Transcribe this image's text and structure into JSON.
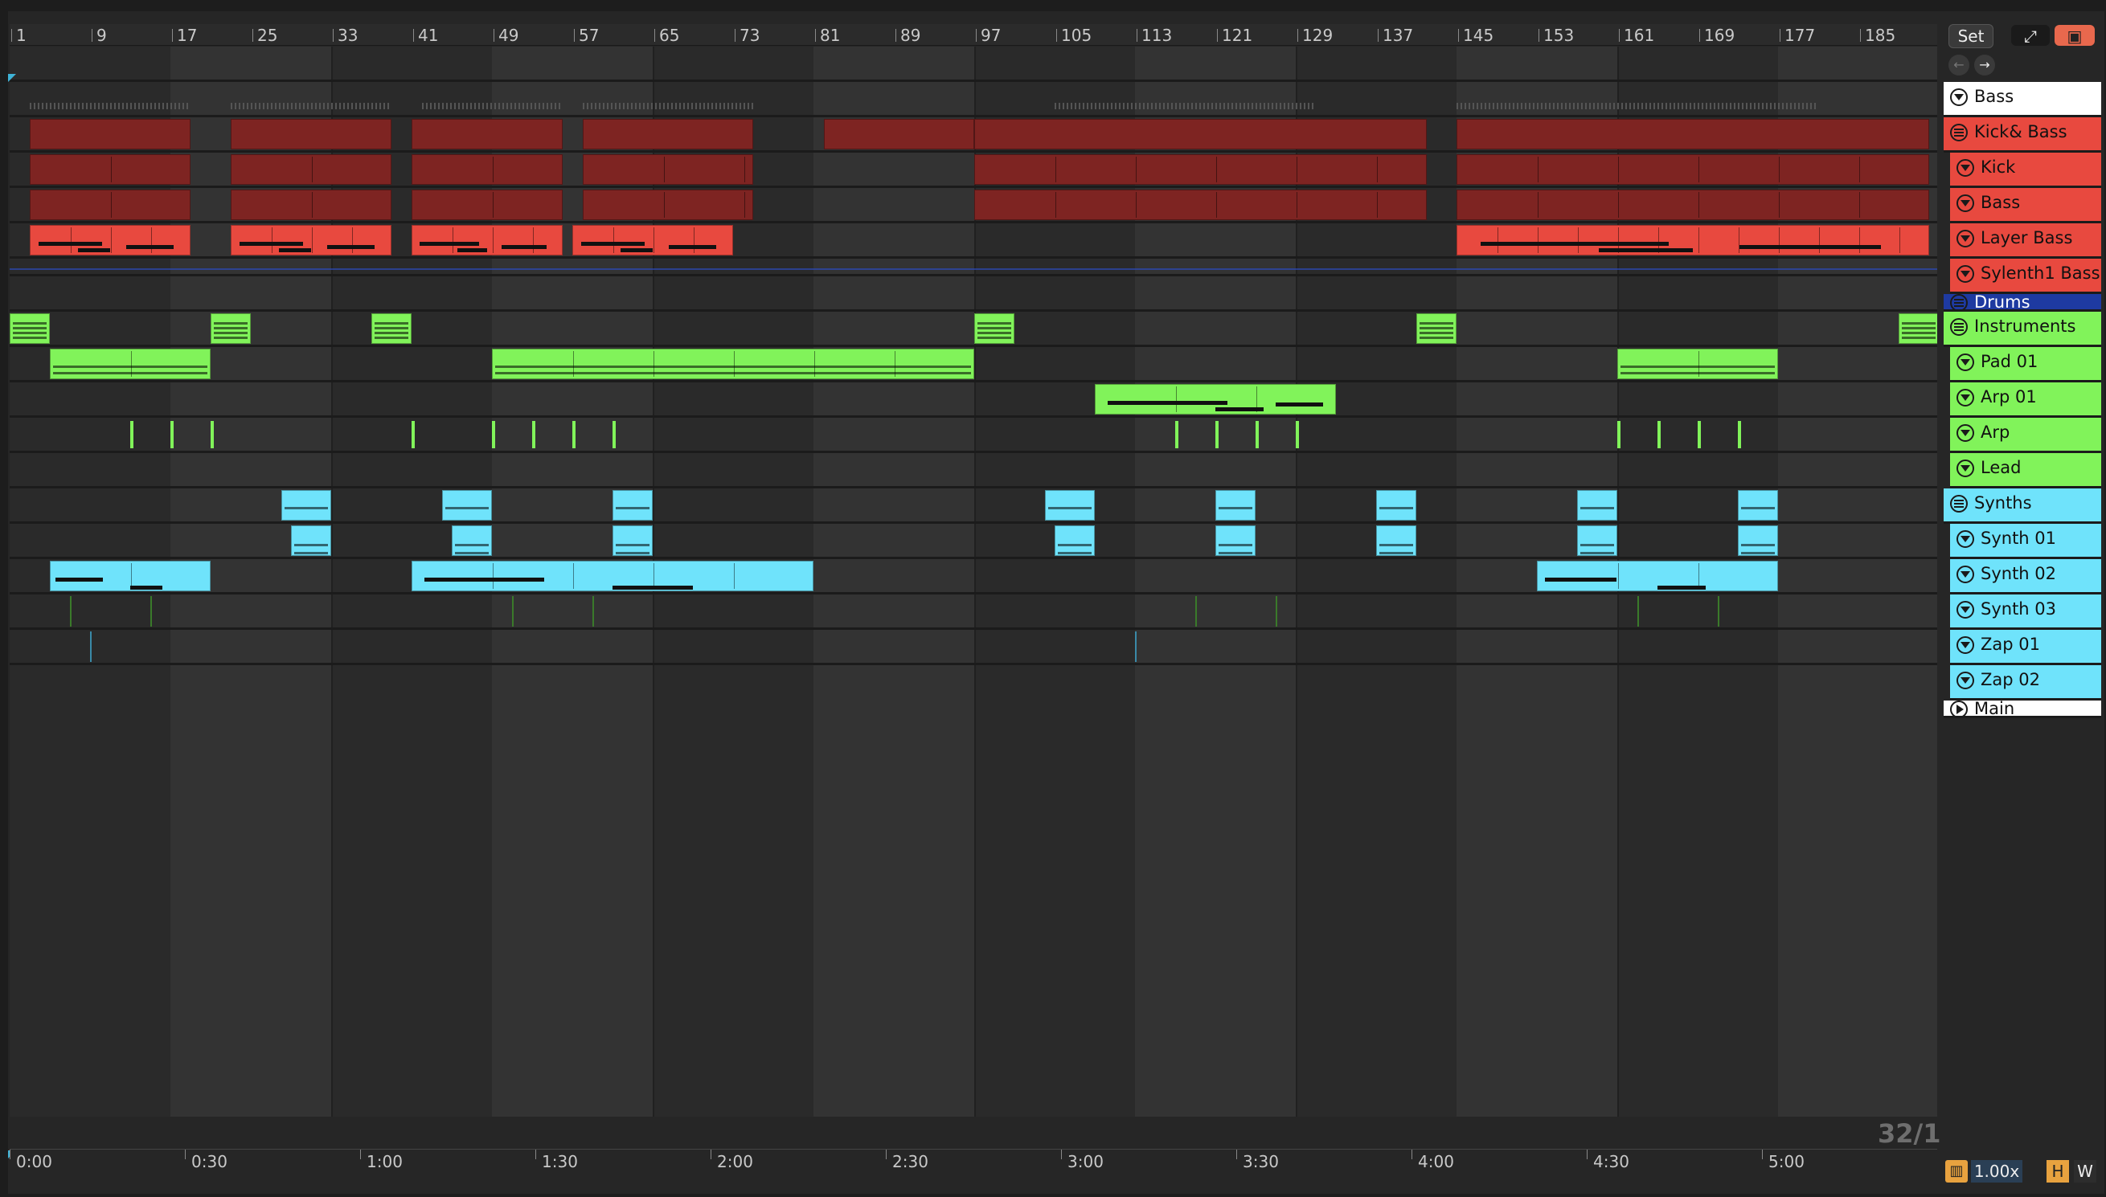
{
  "ruler": {
    "bars": [
      "1",
      "9",
      "17",
      "25",
      "33",
      "41",
      "49",
      "57",
      "65",
      "73",
      "81",
      "89",
      "97",
      "105",
      "113",
      "121",
      "129",
      "137",
      "145",
      "153",
      "161",
      "169",
      "177",
      "185"
    ]
  },
  "timeline": {
    "labels": [
      "0:00",
      "0:30",
      "1:00",
      "1:30",
      "2:00",
      "2:30",
      "3:00",
      "3:30",
      "4:00",
      "4:30",
      "5:00"
    ]
  },
  "controls": {
    "set_label": "Set",
    "grid_label": "32/1",
    "zoom_value": "1.00x",
    "h_label": "H",
    "w_label": "W"
  },
  "colors": {
    "red_group": "#e8493f",
    "red_clip_dark": "#7e2422",
    "green": "#81f35a",
    "cyan": "#6fe3fb",
    "drums_blue": "#1e3aa1",
    "bass_white": "#ffffff"
  },
  "tracks": [
    {
      "name": "Bass",
      "type": "track",
      "color": "#ffffff",
      "icon": "fold-icon"
    },
    {
      "name": "Kick& Bass",
      "type": "group",
      "color": "#e8493f",
      "icon": "group-icon"
    },
    {
      "name": "Kick",
      "type": "track",
      "color": "#e8493f",
      "icon": "fold-icon"
    },
    {
      "name": "Bass",
      "type": "track",
      "color": "#e8493f",
      "icon": "fold-icon"
    },
    {
      "name": "Layer Bass",
      "type": "track",
      "color": "#e8493f",
      "icon": "fold-icon"
    },
    {
      "name": "Sylenth1 Bass",
      "type": "track",
      "color": "#e8493f",
      "icon": "fold-icon"
    },
    {
      "name": "Drums",
      "type": "group",
      "color": "#1e3aa1",
      "icon": "group-icon"
    },
    {
      "name": "Instruments",
      "type": "group",
      "color": "#81f35a",
      "icon": "group-icon"
    },
    {
      "name": "Pad 01",
      "type": "track",
      "color": "#81f35a",
      "icon": "fold-icon"
    },
    {
      "name": "Arp 01",
      "type": "track",
      "color": "#81f35a",
      "icon": "fold-icon"
    },
    {
      "name": "Arp",
      "type": "track",
      "color": "#81f35a",
      "icon": "fold-icon"
    },
    {
      "name": "Lead",
      "type": "track",
      "color": "#81f35a",
      "icon": "fold-icon"
    },
    {
      "name": "Synths",
      "type": "group",
      "color": "#6fe3fb",
      "icon": "group-icon"
    },
    {
      "name": "Synth 01",
      "type": "track",
      "color": "#6fe3fb",
      "icon": "fold-icon"
    },
    {
      "name": "Synth 02",
      "type": "track",
      "color": "#6fe3fb",
      "icon": "fold-icon"
    },
    {
      "name": "Synth 03",
      "type": "track",
      "color": "#6fe3fb",
      "icon": "fold-icon"
    },
    {
      "name": "Zap 01",
      "type": "track",
      "color": "#6fe3fb",
      "icon": "fold-icon"
    },
    {
      "name": "Zap 02",
      "type": "track",
      "color": "#6fe3fb",
      "icon": "fold-icon"
    },
    {
      "name": "Main",
      "type": "main",
      "color": "#ffffff",
      "icon": "play-icon"
    }
  ]
}
